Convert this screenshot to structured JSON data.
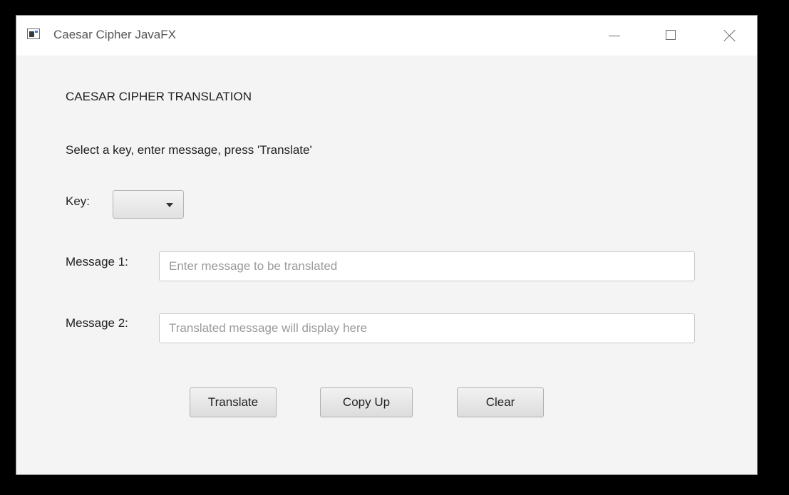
{
  "window": {
    "title": "Caesar Cipher JavaFX"
  },
  "main": {
    "heading": "CAESAR CIPHER TRANSLATION",
    "instructions": "Select a key, enter message, press 'Translate'",
    "key_label": "Key:",
    "key_value": "",
    "message1_label": "Message 1:",
    "message1_value": "",
    "message1_placeholder": "Enter message to be translated",
    "message2_label": "Message 2:",
    "message2_value": "",
    "message2_placeholder": "Translated message will display here"
  },
  "buttons": {
    "translate": "Translate",
    "copy_up": "Copy Up",
    "clear": "Clear"
  },
  "icons": {
    "app": "javafx-window-icon",
    "minimize": "minimize-icon",
    "maximize": "maximize-icon",
    "close": "close-icon",
    "dropdown": "chevron-down-icon"
  },
  "colors": {
    "window_bg": "#f4f4f4",
    "titlebar_bg": "#ffffff",
    "desktop_bg": "#000000"
  }
}
